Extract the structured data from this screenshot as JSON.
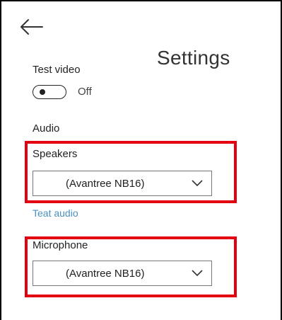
{
  "header": {
    "back_icon": "back-arrow-icon",
    "title": "Settings"
  },
  "test_video": {
    "label": "Test video",
    "toggle_state": "Off",
    "toggle_on": false
  },
  "audio": {
    "section_label": "Audio",
    "speakers": {
      "label": "Speakers",
      "selected": "(Avantree NB16)"
    },
    "test_audio_link": "Teat audio",
    "microphone": {
      "label": "Microphone",
      "selected": "(Avantree NB16)"
    }
  },
  "colors": {
    "highlight": "#e3000f",
    "link": "#4a8fbd"
  }
}
